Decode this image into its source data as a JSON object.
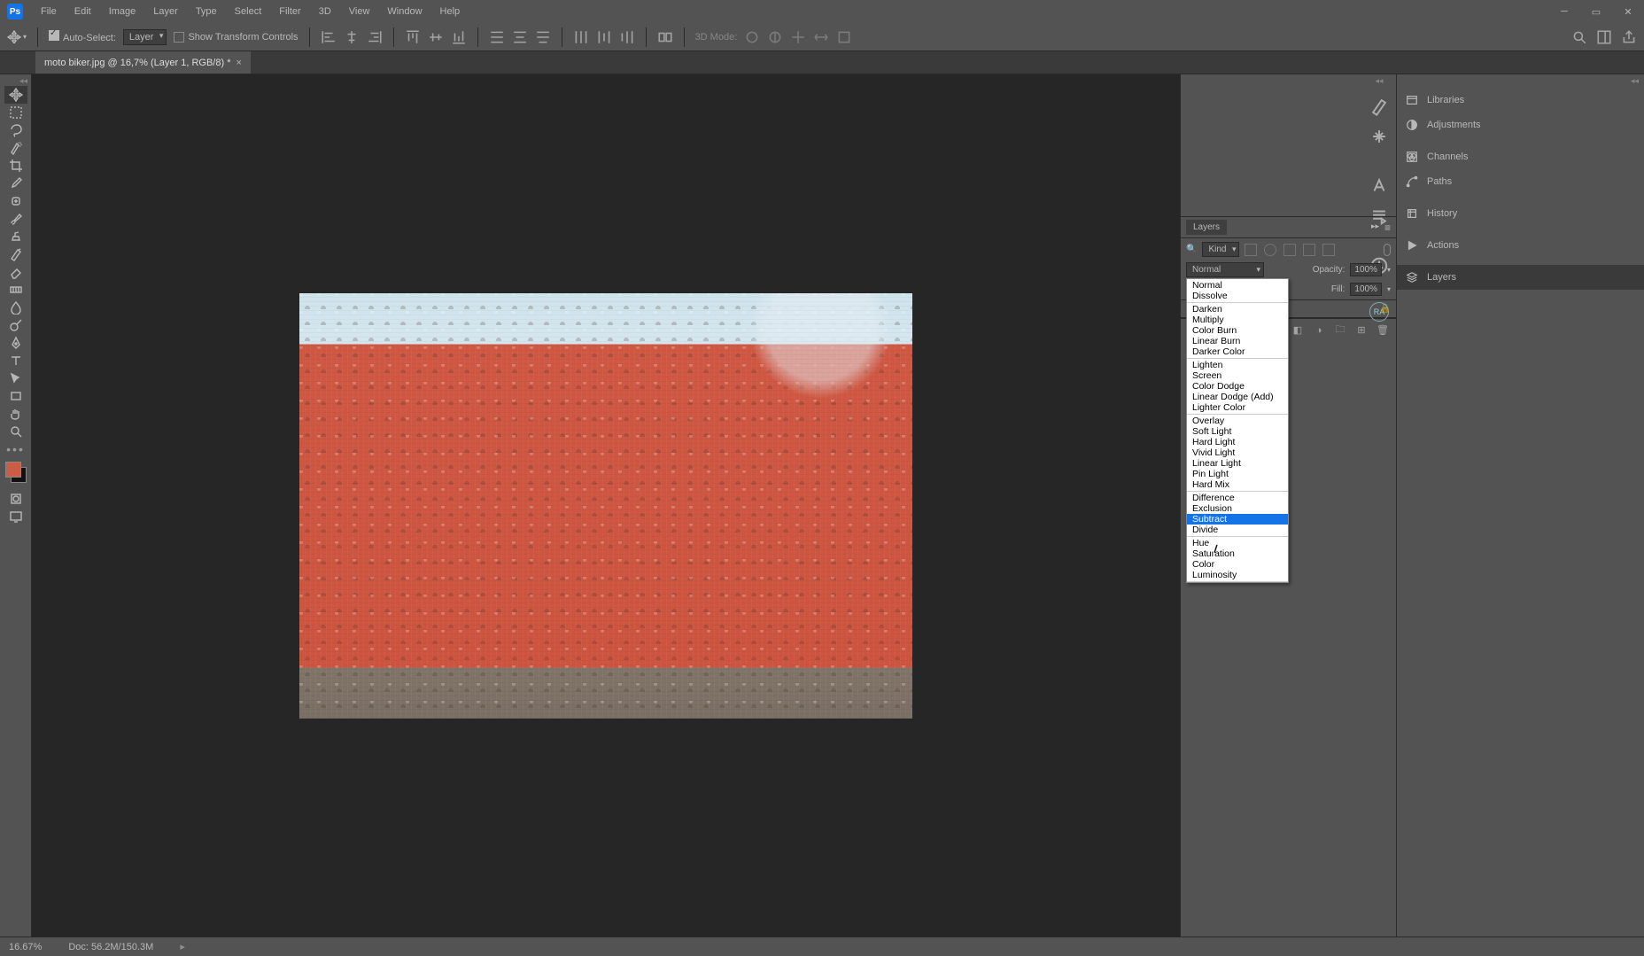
{
  "menubar": {
    "items": [
      "File",
      "Edit",
      "Image",
      "Layer",
      "Type",
      "Select",
      "Filter",
      "3D",
      "View",
      "Window",
      "Help"
    ]
  },
  "optionsbar": {
    "auto_select_label": "Auto-Select:",
    "auto_select_target": "Layer",
    "show_transform_label": "Show Transform Controls",
    "mode_label_3d": "3D Mode:"
  },
  "document_tab": {
    "title": "moto biker.jpg @ 16,7% (Layer 1, RGB/8) *"
  },
  "right_panels": {
    "items": [
      {
        "label": "Libraries"
      },
      {
        "label": "Adjustments"
      },
      {
        "label": "Channels"
      },
      {
        "label": "Paths"
      },
      {
        "label": "History"
      },
      {
        "label": "Actions"
      },
      {
        "label": "Layers"
      }
    ],
    "avatar_initials": "RA"
  },
  "layers_panel": {
    "tab_label": "Layers",
    "kind_label": "Kind",
    "blend_mode_current": "Normal",
    "opacity_label": "Opacity:",
    "opacity_value": "100%",
    "fill_label": "Fill:",
    "fill_value": "100%"
  },
  "blend_modes": {
    "groups": [
      [
        "Normal",
        "Dissolve"
      ],
      [
        "Darken",
        "Multiply",
        "Color Burn",
        "Linear Burn",
        "Darker Color"
      ],
      [
        "Lighten",
        "Screen",
        "Color Dodge",
        "Linear Dodge (Add)",
        "Lighter Color"
      ],
      [
        "Overlay",
        "Soft Light",
        "Hard Light",
        "Vivid Light",
        "Linear Light",
        "Pin Light",
        "Hard Mix"
      ],
      [
        "Difference",
        "Exclusion",
        "Subtract",
        "Divide"
      ],
      [
        "Hue",
        "Saturation",
        "Color",
        "Luminosity"
      ]
    ],
    "highlighted": "Subtract"
  },
  "statusbar": {
    "zoom": "16.67%",
    "doc_info": "Doc: 56.2M/150.3M"
  },
  "colors": {
    "foreground": "#cd5c47",
    "background": "#111111",
    "accent": "#1473e6"
  }
}
